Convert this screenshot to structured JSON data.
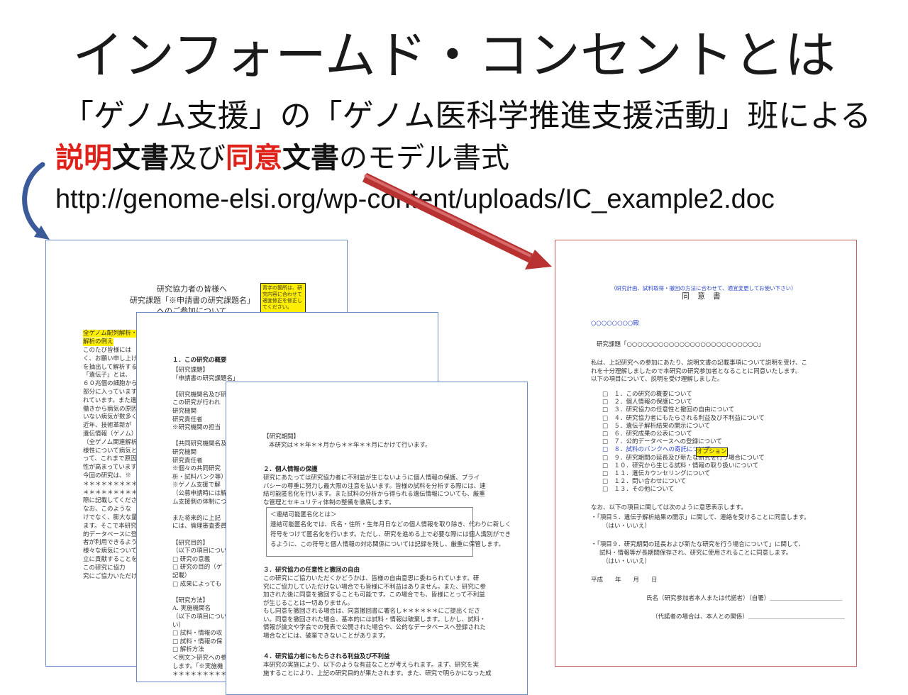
{
  "title": "インフォームド・コンセントとは",
  "subtitle": "「ゲノム支援」の「ゲノム医科学推進支援活動」班による",
  "heading": {
    "part1_red": "説明",
    "part2_bold": "文書",
    "part3": "及び",
    "part4_red": "同意",
    "part5_bold": "文書",
    "part6": "のモデル書式"
  },
  "url": "http://genome-elsi.org/wp-content/uploads/IC_example2.doc",
  "colors": {
    "accent_red": "#e0211a",
    "arrow_red": "#b83232",
    "arrow_blue": "#3a5a9a"
  },
  "doc_a": {
    "l1": "研究協力者の皆様へ",
    "l2": "研究課題「※申請書の研究課題名」",
    "l3": "へのご参加について",
    "note": "青字の箇所は、研究内容に合わせて適宜修正を修正してください。",
    "h1": "全ゲノム配列解析・",
    "h2": "解析の例え",
    "p": [
      "このたび皆様には",
      "く、お願い申し上げ",
      "を抽出して解析する",
      "「遺伝子」とは、",
      "６０兆個の細胞から",
      "部分に入っています",
      "れています。また遺",
      "働きから病気の原因",
      "いない病気が数多く",
      "近年、技術革新が",
      "遺伝情報（ゲノム）",
      "（全ゲノム関連解析",
      "様性について病気と",
      "って、これまで原因",
      "性が高まっています",
      "今回の研究は、※",
      "＊＊＊＊＊＊＊＊＊",
      "＊＊＊＊＊＊＊＊＊",
      "際に記載してくださ",
      "なお、このような",
      "けでなく、膨大な量",
      "ます。そこで本研究",
      "的データベースに登",
      "者が利用できるよう",
      "様々な病気について",
      "立に貢献することを",
      "この研究に協力",
      "究にご協力いただけ"
    ]
  },
  "doc_b": {
    "h1": "１．この研究の概要",
    "p": [
      "【研究課題】",
      "「申請書の研究課題名」",
      "",
      "【研究機関名及び研",
      "この研究が行われ",
      "研究機関",
      "研究責任者",
      "※研究機関の担当",
      "",
      "【共同研究機関名及",
      "研究機関",
      "研究責任者",
      "※個々の共同研究",
      "析・試料バンク等）",
      "※ゲノム支援で解",
      "（公募申請時には解",
      "ム支援側の体制につ",
      "",
      "また将来的に上記",
      "には、倫理審査委員",
      "",
      "【研究目的】",
      "（以下の項目につい",
      "□ 研究の意義",
      "□ 研究の目的（ゲ",
      "記載）",
      "□ 成果によっても",
      "",
      "【研究方法】",
      "A. 実施機関名",
      "（以下の項目につい",
      "い）",
      "□ 試料・情報の収",
      "□ 試料・情報の保",
      "□ 解析方法",
      "＜例文＞研究への参",
      "します。「※実施機",
      "＊＊＊＊＊＊＊＊＊"
    ]
  },
  "doc_c": {
    "p1": "【研究期間】",
    "p2": "本研究は＊＊年＊＊月から＊＊年＊＊月にかけて行います。",
    "h2": "２．個人情報の保護",
    "p3": [
      "研究にあたっては研究協力者に不利益が生じないように個人情報の保護、プライ",
      "バシーの尊重に努力し最大限の注意を払います。皆様の試料を分析する際には、連",
      "結可能匿名化を行います。また試料の分析から得られる遺伝情報についても、厳重",
      "な管理とセキュリティ体制の整備を徹底します。"
    ],
    "box": [
      "＜連結可能匿名化とは＞",
      "連結可能匿名化では、氏名・住所・生年月日などの個人情報を取り除き、代わりに新しく",
      "符号をつけて匿名化を行います。ただし、研究を進める上で必要な際には個人識別ができ",
      "るように、この符号と個人情報の対応関係については記録を残し、厳重に保管します。"
    ],
    "h3": "３．研究協力の任意性と撤回の自由",
    "p4": [
      "この研究にご協力いただくかどうかは、皆様の自由意思に委ねられています。研",
      "究にご協力していただけない場合でも皆様に不利益はありません。また、研究に参",
      "加された後に同意を撤回することも可能です。この場合でも、皆様にとって不利益",
      "が生じることは一切ありません。",
      "もし同意を撤回される場合は、同意撤回書に署名し＊＊＊＊＊＊にご提出くださ",
      "い。同意を撤回された場合、基本的には試料・情報は破棄します。しかし、試料・",
      "情報が論文や学会での発表で公開された場合や、公的なデータベースへ登録された",
      "場合などには、破棄できないことがあります。"
    ],
    "h4": "４．研究協力者にもたらされる利益及び不利益",
    "p5": [
      "本研究の実施により、以下のような有益なことが考えられます。まず、研究を実",
      "施することにより、上記の研究目的が果たされます。また、研究で明らかになった成"
    ]
  },
  "doc_d": {
    "top": "（研究計画、試料取得・撤回の方法に合わせて、適宜変更してお使い下さい）",
    "title": "同　意　書",
    "addr": "○○○○○○○○殿",
    "subject": "研究課題「○○○○○○○○○○○○○○○○○○○○○○○○○」",
    "p1": [
      "私は、上記研究への参加にあたり、説明文書の記載事項について説明を受け、こ",
      "れを十分理解しましたので本研究の研究参加者となることに同意いたします。",
      "以下の項目について、説明を受け理解しました。"
    ],
    "items": [
      "□　１．この研究の概要について",
      "□　２．個人情報の保護について",
      "□　３．研究協力の任意性と撤回の自由について",
      "□　４．研究協力者にもたらされる利益及び不利益について",
      "□　５．遺伝子解析結果の開示について",
      "□　６．研究成果の公表について",
      "□　７．公的データベースへの登録について",
      "□　８．試料のバンクへの寄託について",
      "□　９．研究期間の延長及び新たな研究を行う場合について",
      "□　１０．研究から生じる試料・情報の取り扱いについて",
      "□　１１．遺伝カウンセリングについて",
      "□　１２．問い合わせについて",
      "□　１３．その他について"
    ],
    "option": "オプション",
    "p2": "なお、以下の項目に関しては次のように意思表示します。",
    "q1a": "・「項目５．遺伝子解析結果の開示」に関して、連絡を受けることに同意します。",
    "q1b": "（はい・いいえ）",
    "q2a": "・「項目９．研究期間の延長および新たな研究を行う場合について」に関して、",
    "q2b": "試料・情報等が長期間保存され、研究に使用されることに同意します。",
    "q2c": "（はい・いいえ）",
    "date": "平成　　年　　月　　日",
    "sign1": "氏名（研究参加者本人または代諾者）（自署）＿＿＿＿＿＿＿＿＿＿＿＿",
    "sign2": "（代諾者の場合は、本人との関係）＿＿＿＿＿＿＿＿＿＿＿＿＿＿＿＿"
  }
}
